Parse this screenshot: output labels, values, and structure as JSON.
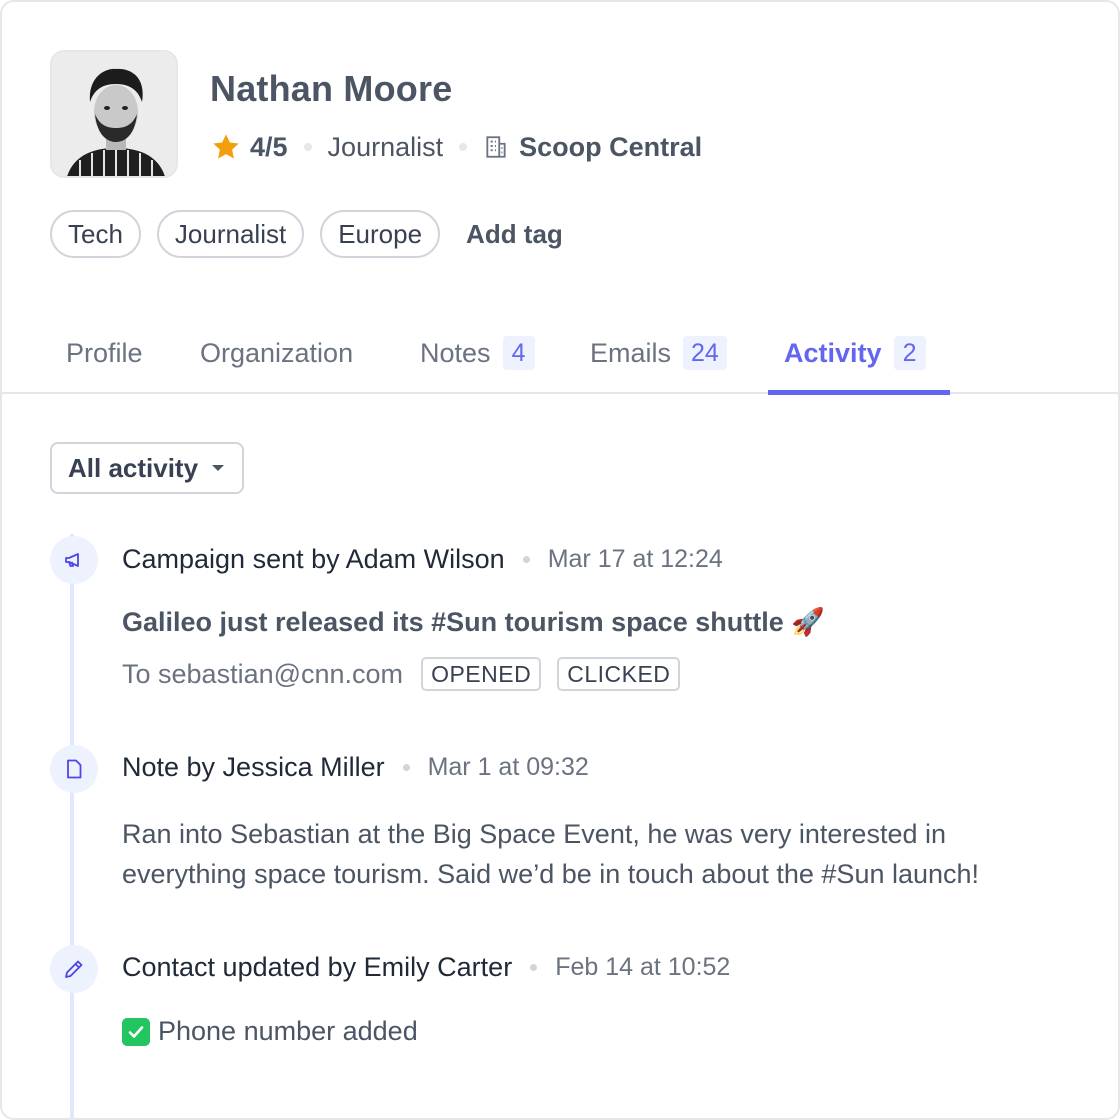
{
  "contact": {
    "name": "Nathan Moore",
    "rating": "4/5",
    "role": "Journalist",
    "organization": "Scoop Central",
    "tags": [
      "Tech",
      "Journalist",
      "Europe"
    ],
    "add_tag_label": "Add tag"
  },
  "tabs": [
    {
      "label": "Profile",
      "count": null
    },
    {
      "label": "Organization",
      "count": null
    },
    {
      "label": "Notes",
      "count": "4"
    },
    {
      "label": "Emails",
      "count": "24"
    },
    {
      "label": "Activity",
      "count": "2",
      "active": true
    }
  ],
  "filter": {
    "label": "All activity"
  },
  "activity": [
    {
      "type": "campaign",
      "icon": "megaphone-icon",
      "title": "Campaign sent by Adam Wilson",
      "time": "Mar 17 at 12:24",
      "subject": "Galileo just released its #Sun tourism space shuttle 🚀",
      "recipient": "To sebastian@cnn.com",
      "statuses": [
        "OPENED",
        "CLICKED"
      ]
    },
    {
      "type": "note",
      "icon": "note-icon",
      "title": "Note by Jessica Miller",
      "time": "Mar 1 at 09:32",
      "body_line1": "Ran into Sebastian at the Big Space Event, he was very interested in",
      "body_line2": "everything space tourism. Said we’d be in touch about the #Sun launch!"
    },
    {
      "type": "update",
      "icon": "pencil-icon",
      "title": "Contact updated by Emily Carter",
      "time": "Feb 14 at 10:52",
      "body": "Phone number added"
    }
  ],
  "colors": {
    "accent": "#6366f1",
    "accent_light": "#eef2ff",
    "star": "#f59e0b",
    "check": "#22c55e"
  }
}
